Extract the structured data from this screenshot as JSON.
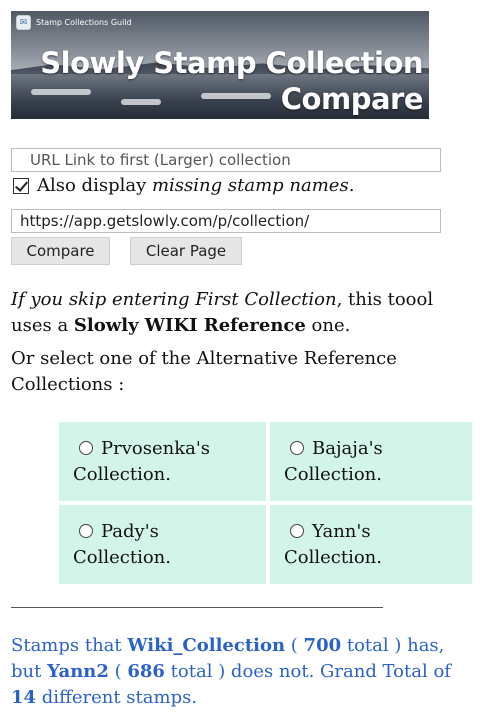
{
  "banner": {
    "guild_name": "Stamp Collections Guild",
    "title_line1": "Slowly Stamp Collection",
    "title_line2": "Compare"
  },
  "form": {
    "first_url_placeholder": "URL Link to first (Larger) collection",
    "checkbox_label_prefix": "Also display ",
    "checkbox_label_emph": "missing stamp names",
    "checkbox_label_suffix": ".",
    "checkbox_checked": true,
    "second_url_value": "https://app.getslowly.com/p/collection/",
    "compare_label": "Compare",
    "clear_label": "Clear Page"
  },
  "info": {
    "p1_emph": "If you skip entering First Collection",
    "p1_mid": ", this toool uses a ",
    "p1_bold": "Slowly WIKI Reference",
    "p1_end": " one.",
    "p2": "Or select one of the Alternative Reference Collections :"
  },
  "alternatives": [
    {
      "label": "Prvosenka's Collection."
    },
    {
      "label": "Bajaja's Collection."
    },
    {
      "label": "Pady's Collection."
    },
    {
      "label": "Yann's Collection."
    }
  ],
  "result": {
    "t1": "Stamps that ",
    "collection_a": "Wiki_Collection",
    "t2": " ( ",
    "total_a": "700",
    "t3": " total ) has, but ",
    "collection_b": "Yann2",
    "t4": " ( ",
    "total_b": "686",
    "t5": " total ) does not. Grand Total of ",
    "diff_count": "14",
    "t6": " different stamps."
  },
  "colors": {
    "option_bg": "#d3f5e9",
    "result_text": "#2a62c9"
  }
}
